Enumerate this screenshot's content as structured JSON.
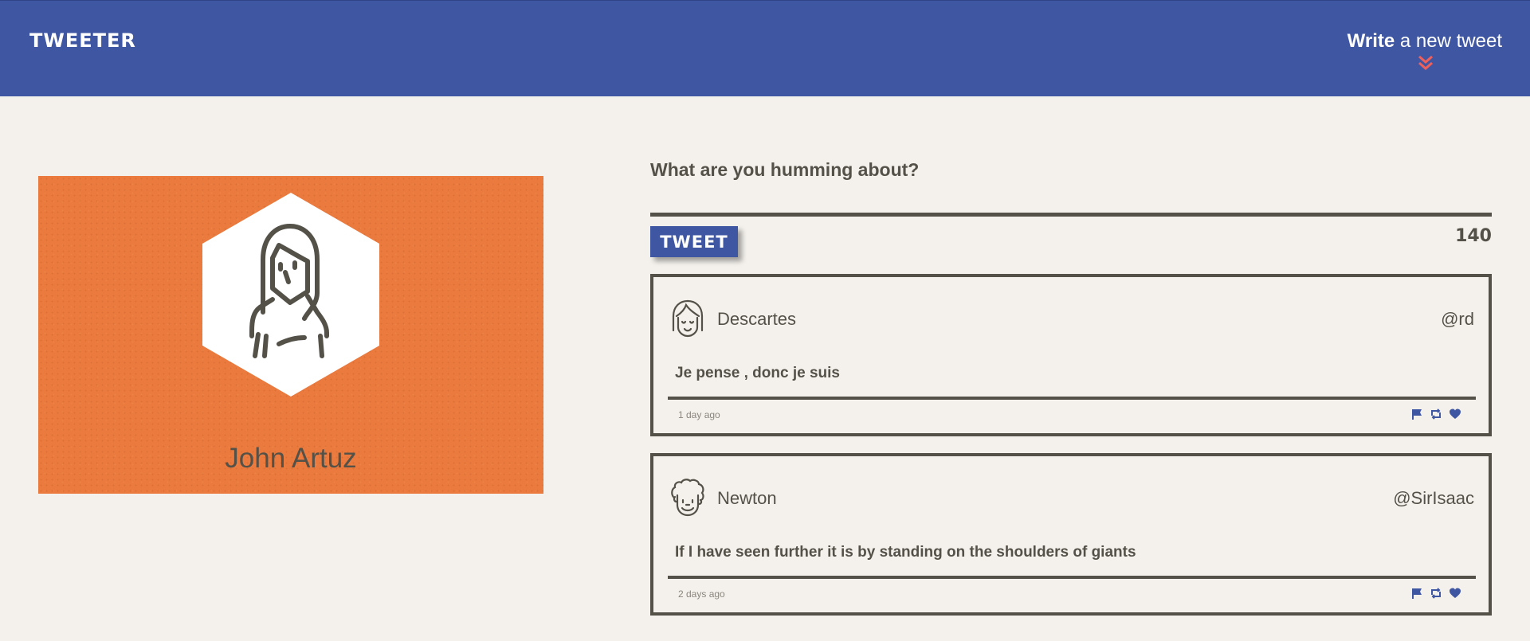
{
  "header": {
    "brand": "TWEETER",
    "compose_toggle": {
      "strong": "Write",
      "rest": " a new tweet"
    },
    "chevron_icon": "double-chevron-down-icon",
    "background": "#3f56a3",
    "accent": "#f0605a"
  },
  "profile": {
    "name": "John Artuz",
    "avatar_icon": "woman-avatar-icon",
    "background": "#ea7a3e"
  },
  "composer": {
    "prompt": "What are you humming about?",
    "button_label": "TWEET",
    "counter": "140"
  },
  "tweets": [
    {
      "author": "Descartes",
      "handle": "@rd",
      "avatar_icon": "girl-avatar-icon",
      "text": "Je pense , donc je suis",
      "age": "1 day ago",
      "actions": [
        "flag-icon",
        "retweet-icon",
        "heart-icon"
      ]
    },
    {
      "author": "Newton",
      "handle": "@SirIsaac",
      "avatar_icon": "curly-hair-avatar-icon",
      "text": "If I have seen further it is by standing on the shoulders of giants",
      "age": "2 days ago",
      "actions": [
        "flag-icon",
        "retweet-icon",
        "heart-icon"
      ]
    }
  ]
}
